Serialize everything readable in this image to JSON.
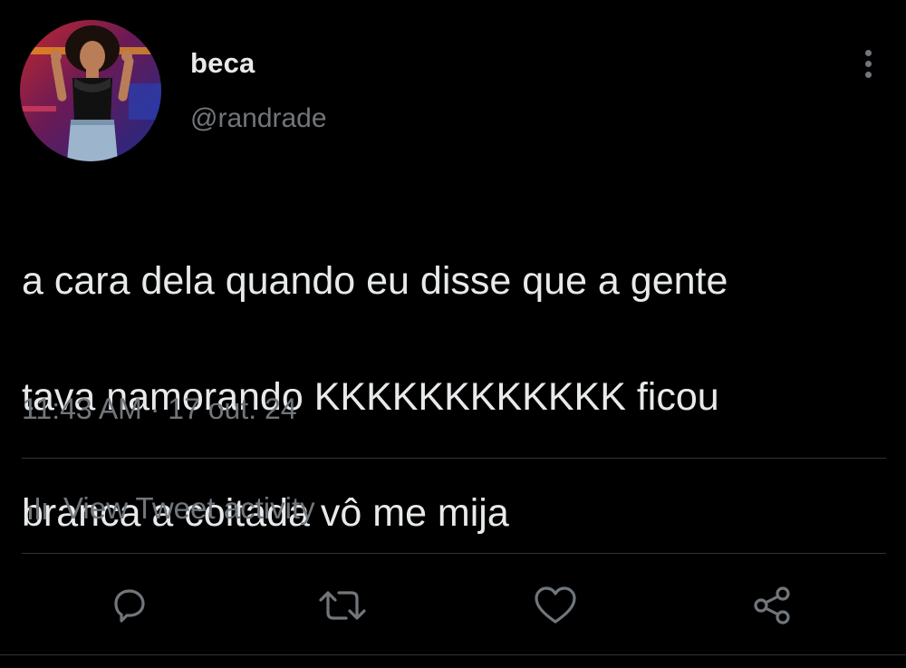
{
  "user": {
    "display_name": "beca",
    "handle": "@randrade"
  },
  "tweet": {
    "text_lines": [
      "a cara dela quando eu disse que a gente",
      "tava namorando KKKKKKKKKKKK ficou",
      "branca a coitada vô me mija"
    ],
    "time": "11:43 AM",
    "separator": "·",
    "date": "17 out. 24"
  },
  "activity": {
    "label": "View Tweet activity",
    "icon": "bar-chart-icon"
  },
  "actions": [
    {
      "name": "reply",
      "icon": "reply-icon"
    },
    {
      "name": "retweet",
      "icon": "retweet-icon"
    },
    {
      "name": "like",
      "icon": "heart-icon"
    },
    {
      "name": "share",
      "icon": "share-icon"
    }
  ],
  "menu_icon": "more-vertical-icon",
  "colors": {
    "background": "#000000",
    "primary_text": "#e7e9ea",
    "secondary_text": "#71767b",
    "divider": "#2f3336"
  }
}
